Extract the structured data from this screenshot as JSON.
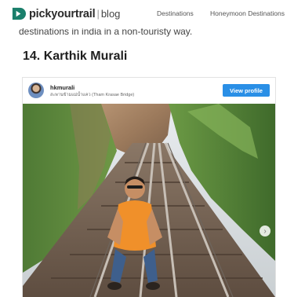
{
  "header": {
    "logo_text": "pickyourtrail",
    "logo_separator": "|",
    "logo_suffix": "blog",
    "nav": [
      {
        "label": "Destinations"
      },
      {
        "label": "Honeymoon Destinations"
      }
    ]
  },
  "article": {
    "intro_text": "destinations in india in a non-touristy way.",
    "section_heading": "14. Karthik Murali"
  },
  "post": {
    "username": "hkmurali",
    "location": "สะพานข้ามแม่น้ำแคว (Tham Krasae Bridge)",
    "follow_label": "View profile",
    "next_icon": "chevron-right-icon"
  },
  "colors": {
    "brand": "#1a7f6b",
    "button": "#2a8fe6"
  }
}
